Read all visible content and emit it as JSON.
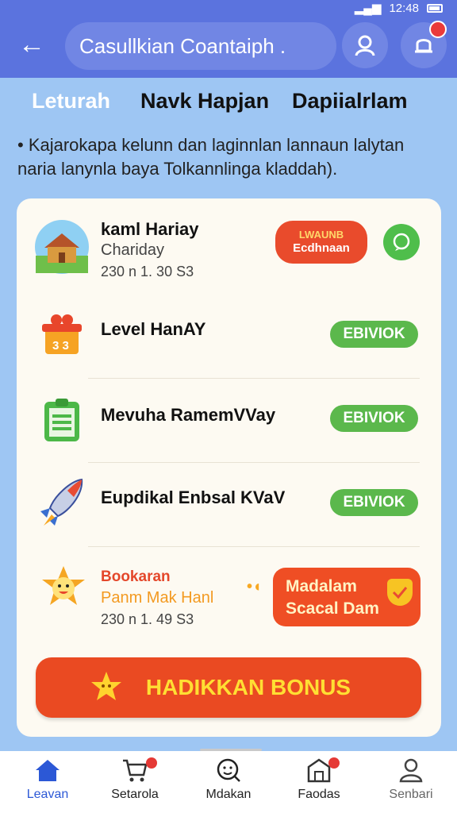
{
  "status": {
    "time": "12:48"
  },
  "header": {
    "search_text": "Casullkian Coantaiph ."
  },
  "tabs": [
    {
      "label": "Leturah",
      "active": true
    },
    {
      "label": "Navk Hapjan",
      "active": false
    },
    {
      "label": "Dapiialrlam",
      "active": false
    }
  ],
  "description": "• Kajarokapa kelunn dan laginnlan lannaun lalytan naria lanynla baya Tolkannlinga kladdah).",
  "items": [
    {
      "title": "kaml Hariay",
      "subtitle": "Chariday",
      "meta": "230 n 1. 30 S3",
      "action1_l1": "LWAUNB",
      "action1_l2": "Ecdhnaan"
    },
    {
      "title": "Level HanAY",
      "action": "EBIVIOK"
    },
    {
      "title": "Mevuha RamemVVay",
      "action": "EBIVIOK"
    },
    {
      "title": "Eupdikal Enbsal KVaV",
      "action": "EBIVIOK"
    },
    {
      "title": "Bookaran",
      "subtitle": "Panm Mak Hanl",
      "meta": "230 n 1. 49 S3",
      "action_l1": "Madalam",
      "action_l2": "Scacal Dam"
    }
  ],
  "bonus_label": "HADIKKAN BONUS",
  "bottom_nav": [
    {
      "label": "Leavan",
      "active": true
    },
    {
      "label": "Setarola",
      "active": false
    },
    {
      "label": "Mdakan",
      "active": false
    },
    {
      "label": "Faodas",
      "active": false
    },
    {
      "label": "Senbari",
      "active": false
    }
  ],
  "colors": {
    "header": "#5b73de",
    "accent_green": "#5bb84c",
    "accent_red": "#ea4a22",
    "bonus_text": "#ffdf33"
  }
}
